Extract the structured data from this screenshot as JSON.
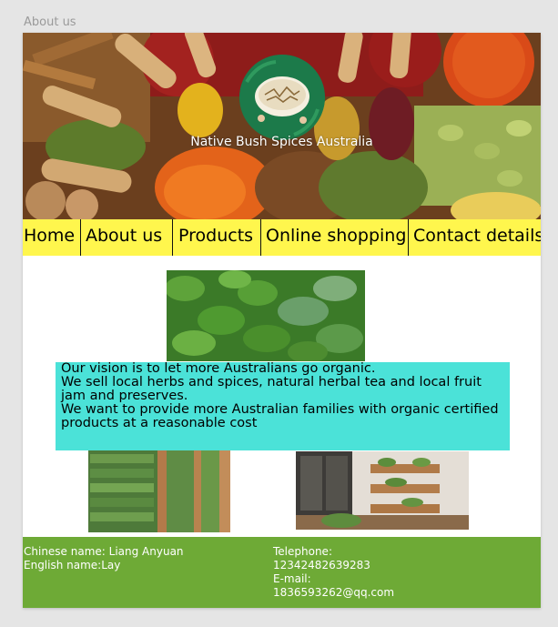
{
  "frame": {
    "title": "About us"
  },
  "header": {
    "brand": "Native Bush Spices Australia"
  },
  "nav": {
    "items": [
      "Home",
      "About us",
      "Products",
      "Online shopping",
      "Contact details"
    ]
  },
  "vision": {
    "line1": "Our vision is to let more Australians go organic.",
    "line2": "We sell local herbs and spices, natural herbal tea and local fruit jam and preserves.",
    "line3": "We want to provide more Australian families with organic certified products at a reasonable cost"
  },
  "footer": {
    "chinese_name": "Chinese name: Liang Anyuan",
    "english_name": "English name:Lay",
    "telephone_label": "Telephone:",
    "telephone": "12342482639283",
    "email_label": "E-mail:",
    "email": "1836593262@qq.com"
  },
  "colors": {
    "nav_bg": "#fff64d",
    "vision_bg": "#4be2d8",
    "footer_bg": "#6eaa36",
    "logo_bg": "#1c7a4a"
  }
}
